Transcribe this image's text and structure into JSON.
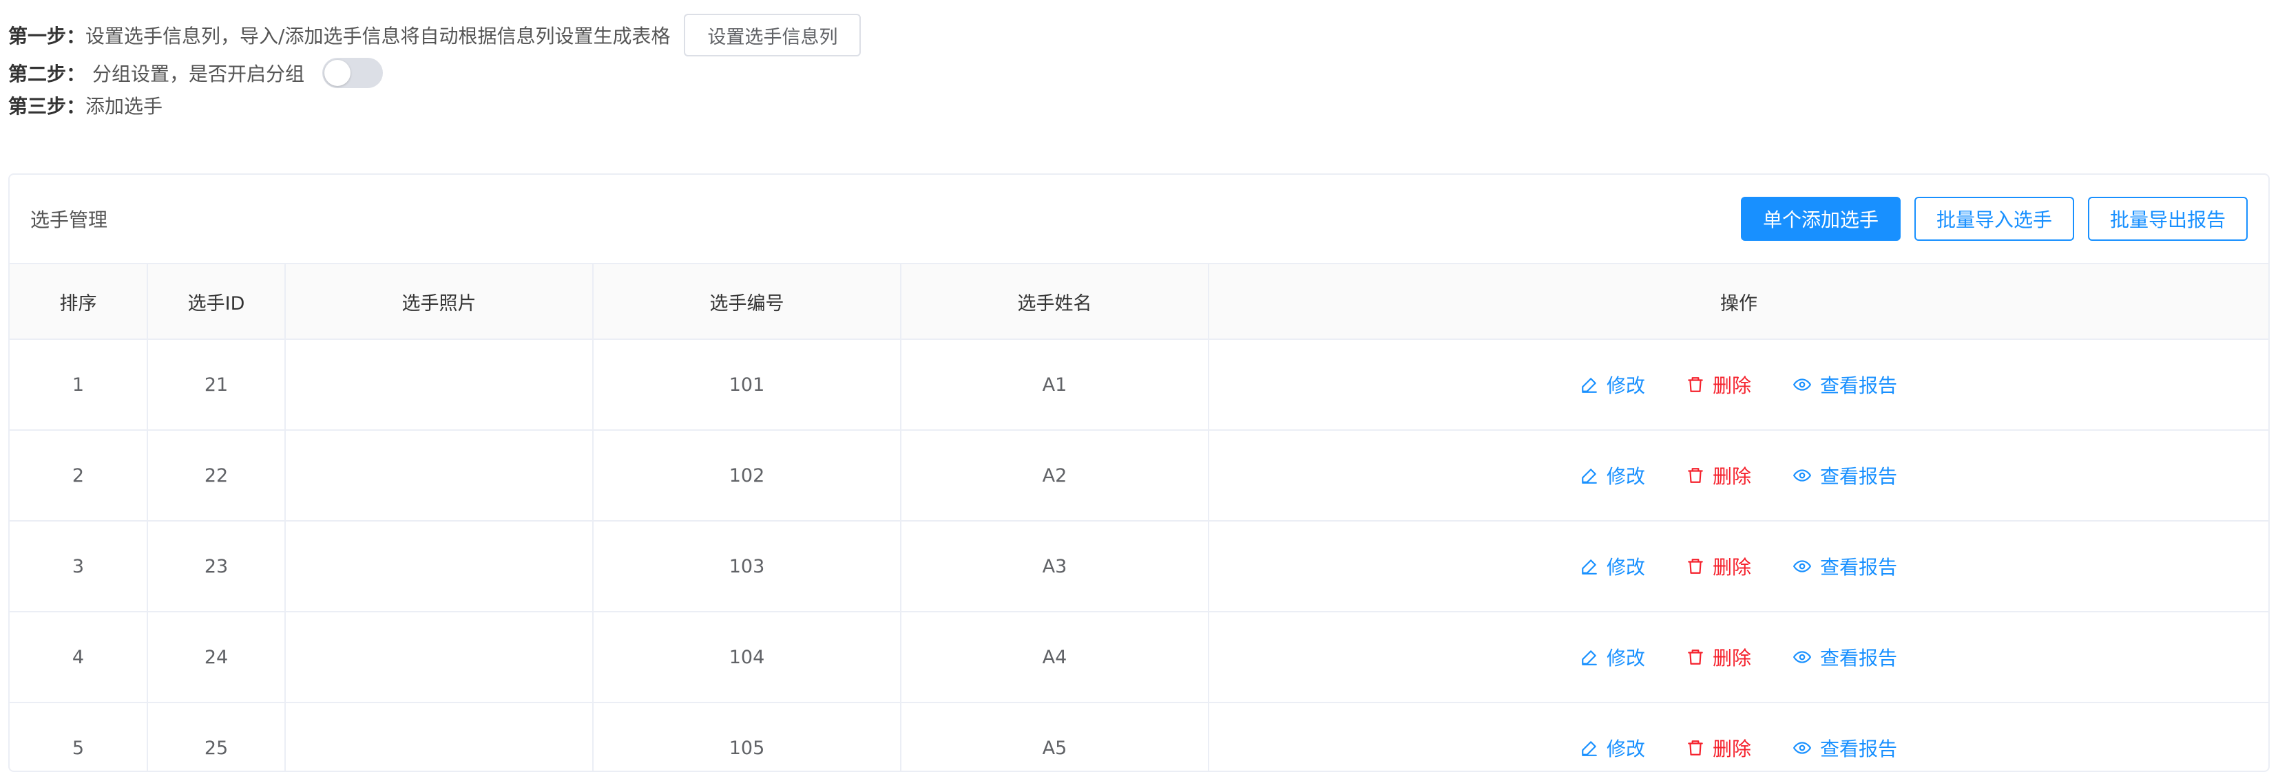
{
  "steps": {
    "step1": {
      "label": "第一步：",
      "text": "设置选手信息列，导入/添加选手信息将自动根据信息列设置生成表格",
      "button": "设置选手信息列"
    },
    "step2": {
      "label": "第二步：",
      "text": "分组设置，是否开启分组",
      "toggle_on": false
    },
    "step3": {
      "label": "第三步：",
      "text": "添加选手"
    }
  },
  "panel": {
    "title": "选手管理",
    "buttons": {
      "add_single": "单个添加选手",
      "batch_import": "批量导入选手",
      "batch_export": "批量导出报告"
    }
  },
  "table": {
    "columns": [
      "排序",
      "选手ID",
      "选手照片",
      "选手编号",
      "选手姓名",
      "操作"
    ],
    "rows": [
      {
        "order": "1",
        "id": "21",
        "photo": "",
        "number": "101",
        "name": "A1"
      },
      {
        "order": "2",
        "id": "22",
        "photo": "",
        "number": "102",
        "name": "A2"
      },
      {
        "order": "3",
        "id": "23",
        "photo": "",
        "number": "103",
        "name": "A3"
      },
      {
        "order": "4",
        "id": "24",
        "photo": "",
        "number": "104",
        "name": "A4"
      },
      {
        "order": "5",
        "id": "25",
        "photo": "",
        "number": "105",
        "name": "A5"
      }
    ],
    "actions": {
      "edit": "修改",
      "delete": "删除",
      "view": "查看报告"
    }
  },
  "colors": {
    "primary": "#1890ff",
    "danger": "#f5222d",
    "border": "#ebeef5",
    "header_bg": "#fafafa"
  }
}
